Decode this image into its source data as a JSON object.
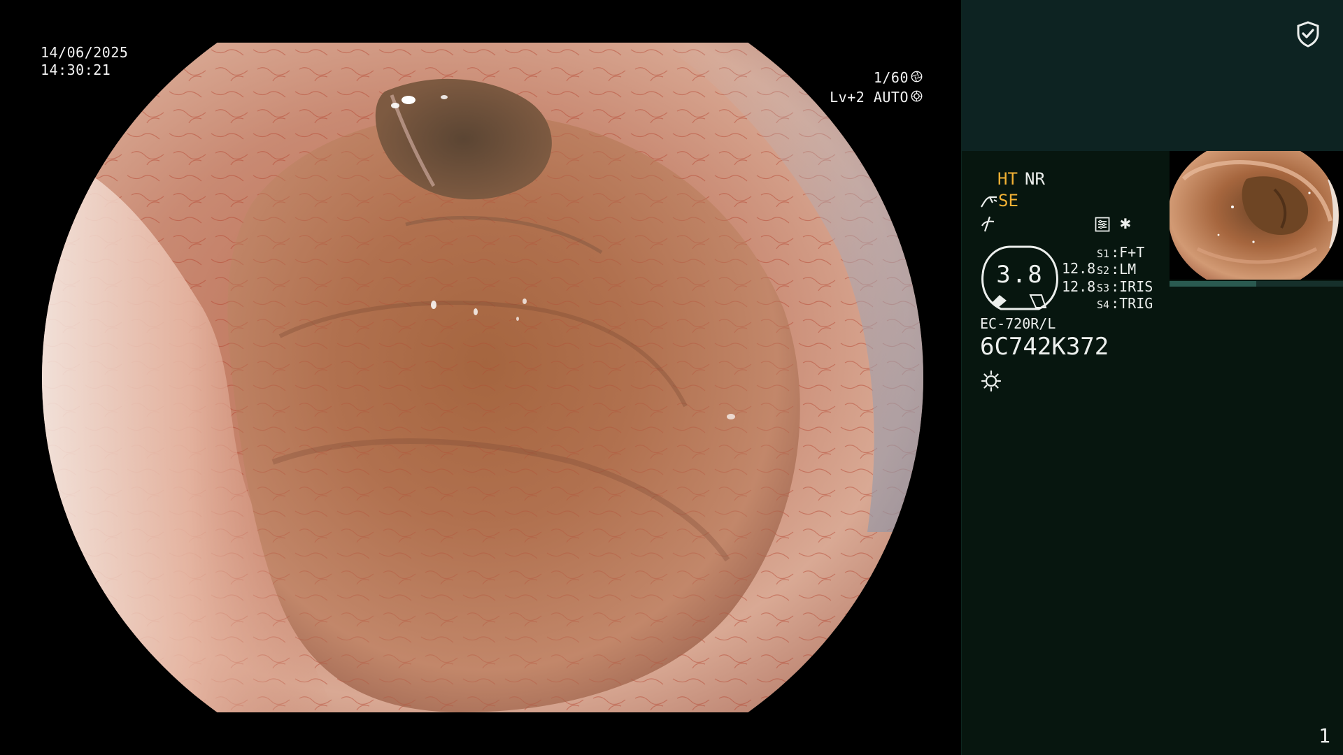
{
  "overlay": {
    "date": "14/06/2025",
    "time": "14:30:21",
    "shutter": "1/60",
    "shutter_icon": "aperture-icon",
    "level": "Lv+2 AUTO",
    "level_icon": "auto-iris-icon"
  },
  "panel": {
    "security_icon": "shield-check-icon",
    "modes": {
      "ht": "HT",
      "nr": "NR",
      "se": "SE"
    },
    "gauge": {
      "value": "3.8",
      "side_values": [
        "12.8",
        "12.8"
      ]
    },
    "switches": [
      {
        "key": "S1",
        "value": "F+T"
      },
      {
        "key": "S2",
        "value": "LM"
      },
      {
        "key": "S3",
        "value": "IRIS"
      },
      {
        "key": "S4",
        "value": "TRIG"
      }
    ],
    "scope_model": "EC-720R/L",
    "scope_serial": "6C742K372",
    "page_number": "1"
  },
  "colors": {
    "accent_yellow": "#f2b134",
    "panel_bg": "#07160f",
    "panel_top_bg": "#0d2322",
    "text": "#ecefed"
  }
}
